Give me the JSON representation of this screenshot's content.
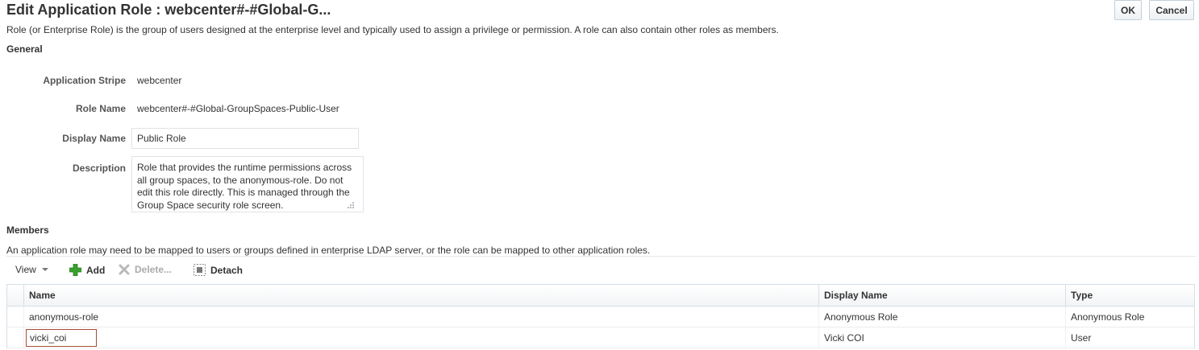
{
  "header": {
    "title": "Edit Application Role : webcenter#-#Global-G...",
    "ok_label": "OK",
    "cancel_label": "Cancel"
  },
  "intro_text": "Role (or Enterprise Role) is the group of users designed at the enterprise level and typically used to assign a privilege or permission. A role can also contain other roles as members.",
  "general": {
    "heading": "General",
    "application_stripe_label": "Application Stripe",
    "application_stripe_value": "webcenter",
    "role_name_label": "Role Name",
    "role_name_value": "webcenter#-#Global-GroupSpaces-Public-User",
    "display_name_label": "Display Name",
    "display_name_value": "Public Role",
    "description_label": "Description",
    "description_value": "Role that provides the runtime permissions across all group spaces, to the anonymous-role. Do not edit this role directly. This is managed through the Group Space security role screen."
  },
  "members": {
    "heading": "Members",
    "info_text": "An application role may need to be mapped to users or groups defined in enterprise LDAP server, or the role can be mapped to other application roles.",
    "toolbar": {
      "view_label": "View",
      "add_label": "Add",
      "delete_label": "Delete...",
      "detach_label": "Detach"
    },
    "columns": {
      "name": "Name",
      "display_name": "Display Name",
      "type": "Type"
    },
    "rows": [
      {
        "name": "anonymous-role",
        "display_name": "Anonymous Role",
        "type": "Anonymous Role"
      },
      {
        "name": "vicki_coi",
        "display_name": "Vicki COI",
        "type": "User"
      }
    ]
  },
  "icons": {
    "view_menu": "chevron-down-icon",
    "add": "plus-icon",
    "delete": "x-icon",
    "detach": "detach-icon"
  },
  "colors": {
    "add_icon": "#3aa02e",
    "edit_cell_border": "#a84b3a"
  }
}
